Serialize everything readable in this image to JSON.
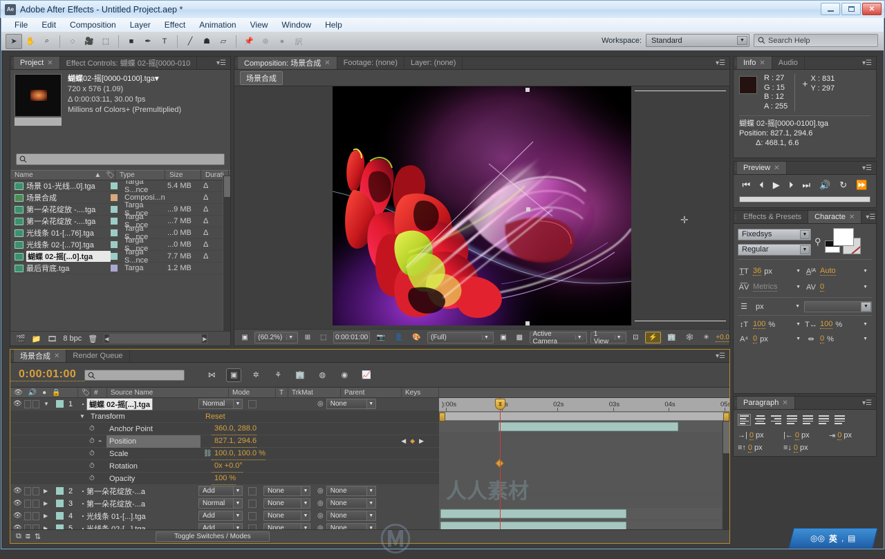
{
  "window": {
    "title": "Adobe After Effects - Untitled Project.aep *",
    "app_badge": "Ae",
    "minimize": "–",
    "maximize": "□",
    "close": "✕"
  },
  "menubar": {
    "items": [
      "File",
      "Edit",
      "Composition",
      "Layer",
      "Effect",
      "Animation",
      "View",
      "Window",
      "Help"
    ]
  },
  "toolbar": {
    "tools": [
      {
        "name": "selection-tool",
        "glyph": "➤",
        "selected": true
      },
      {
        "name": "hand-tool",
        "glyph": "✋",
        "selected": false
      },
      {
        "name": "zoom-tool",
        "glyph": "⌕",
        "selected": false
      },
      {
        "name": "rotation-tool",
        "glyph": "◌",
        "selected": false
      },
      {
        "name": "camera-tool",
        "glyph": "🎥",
        "selected": false
      },
      {
        "name": "pan-behind-tool",
        "glyph": "⬚",
        "selected": false
      },
      {
        "name": "shape-tool",
        "glyph": "■",
        "selected": false
      },
      {
        "name": "pen-tool",
        "glyph": "✒",
        "selected": false
      },
      {
        "name": "type-tool",
        "glyph": "T",
        "selected": false
      },
      {
        "name": "brush-tool",
        "glyph": "╱",
        "selected": false
      },
      {
        "name": "clone-stamp-tool",
        "glyph": "☗",
        "selected": false
      },
      {
        "name": "eraser-tool",
        "glyph": "▱",
        "selected": false
      },
      {
        "name": "puppet-pin-tool",
        "glyph": "📌",
        "selected": false
      }
    ],
    "workspace_label": "Workspace:",
    "workspace_value": "Standard",
    "search_help_placeholder": "Search Help"
  },
  "project_panel": {
    "tabs": [
      {
        "label": "Project",
        "active": true,
        "closeable": true
      },
      {
        "label": "Effect Controls: 蝴蝶 02-摇[0000-010",
        "active": false,
        "closeable": false
      }
    ],
    "selected_item": {
      "name_bold": "蝴蝶",
      "name_rest": "02-摇[0000-0100].tga",
      "dimensions": "720 x 576 (1.09)",
      "duration": "Δ 0:00:03:11, 30.00 fps",
      "colordepth": "Millions of Colors+ (Premultiplied)"
    },
    "search_placeholder": "",
    "columns": [
      "Name",
      "Type",
      "Size",
      "Durati"
    ],
    "items": [
      {
        "name": "场景 01-光线...0].tga",
        "icon": "footage-icon",
        "swatch": "#9ccdc4",
        "type": "Targa S...nce",
        "size": "5.4 MB",
        "dur": "Δ",
        "selected": false
      },
      {
        "name": "场景合成",
        "icon": "composition-icon",
        "swatch": "#d6aa7a",
        "type": "Composi...n",
        "size": "",
        "dur": "Δ",
        "selected": false
      },
      {
        "name": "第一朵花绽放 -....tga",
        "icon": "footage-icon",
        "swatch": "#9ccdc4",
        "type": "Targa S...nce",
        "size": "...9 MB",
        "dur": "Δ",
        "selected": false
      },
      {
        "name": "第一朵花绽放 -....tga",
        "icon": "footage-icon",
        "swatch": "#9ccdc4",
        "type": "Targa S...nce",
        "size": "...7 MB",
        "dur": "Δ",
        "selected": false
      },
      {
        "name": "光线条 01-[...76].tga",
        "icon": "footage-icon",
        "swatch": "#9ccdc4",
        "type": "Targa S...nce",
        "size": "...0 MB",
        "dur": "Δ",
        "selected": false
      },
      {
        "name": "光线条 02-[...70].tga",
        "icon": "footage-icon",
        "swatch": "#9ccdc4",
        "type": "Targa S...nce",
        "size": "...0 MB",
        "dur": "Δ",
        "selected": false
      },
      {
        "name": "蝴蝶 02-摇[...0].tga",
        "icon": "footage-icon",
        "swatch": "#9ccdc4",
        "type": "Targa S...nce",
        "size": "7.7 MB",
        "dur": "Δ",
        "selected": true
      },
      {
        "name": "最后背底.tga",
        "icon": "still-icon",
        "swatch": "#aaa8d0",
        "type": "Targa",
        "size": "1.2 MB",
        "dur": "",
        "selected": false
      }
    ],
    "footer": {
      "bit_depth": "8 bpc",
      "new_comp_icon": "new-composition-icon",
      "new_folder_icon": "new-folder-icon",
      "interpret_icon": "interpret-footage-icon",
      "delete_icon": "delete-icon"
    }
  },
  "comp_panel": {
    "tabs": [
      {
        "label": "Composition: 场景合成",
        "active": true
      },
      {
        "label": "Footage: (none)",
        "active": false
      },
      {
        "label": "Layer: (none)",
        "active": false
      }
    ],
    "breadcrumb": "场景合成",
    "footer": {
      "zoom": "(60.2%)",
      "timecode": "0:00:01:00",
      "resolution": "(Full)",
      "camera": "Active Camera",
      "views": "1 View",
      "exposure": "+0.0"
    }
  },
  "info_panel": {
    "tabs": [
      {
        "label": "Info",
        "active": true
      },
      {
        "label": "Audio",
        "active": false
      }
    ],
    "r_label": "R :",
    "r": "27",
    "g_label": "G :",
    "g": "15",
    "b_label": "B :",
    "b": "12",
    "a_label": "A :",
    "a": "255",
    "x_label": "X :",
    "x": "831",
    "y_label": "Y :",
    "y": "297",
    "swatch_color": "#241210",
    "layer_name": "蝴蝶 02-摇[0000-0100].tga",
    "position": "Position: 827.1, 294.6",
    "delta": "Δ: 468.1, 6.6"
  },
  "preview_panel": {
    "tab": "Preview",
    "buttons": [
      {
        "name": "first-frame-button",
        "glyph": "⏮"
      },
      {
        "name": "previous-frame-button",
        "glyph": "⏴"
      },
      {
        "name": "play-button",
        "glyph": "▶"
      },
      {
        "name": "next-frame-button",
        "glyph": "⏵"
      },
      {
        "name": "last-frame-button",
        "glyph": "⏭"
      },
      {
        "name": "audio-button",
        "glyph": "🔊"
      },
      {
        "name": "loop-button",
        "glyph": "↻"
      },
      {
        "name": "ram-preview-button",
        "glyph": "⏩"
      }
    ]
  },
  "character_panel": {
    "tabs": [
      {
        "label": "Effects & Presets",
        "active": false
      },
      {
        "label": "Characte",
        "active": true
      }
    ],
    "font_family": "Fixedsys",
    "font_style": "Regular",
    "font_size": "36",
    "font_size_unit": "px",
    "leading": "Auto",
    "kerning": "Metrics",
    "tracking": "0",
    "stroke_width": "",
    "stroke_width_unit": "px",
    "vertical_scale": "100",
    "vertical_scale_unit": "%",
    "horizontal_scale": "100",
    "horizontal_scale_unit": "%",
    "baseline_shift": "0",
    "baseline_shift_unit": "px",
    "tsume": "0",
    "tsume_unit": "%"
  },
  "paragraph_panel": {
    "tab": "Paragraph",
    "indent_left": "0",
    "indent_left_unit": "px",
    "indent_right": "0",
    "indent_right_unit": "px",
    "indent_first": "0",
    "indent_first_unit": "px",
    "space_before": "0",
    "space_before_unit": "px",
    "space_after": "0",
    "space_after_unit": "px"
  },
  "timeline": {
    "tabs": [
      {
        "label": "场景合成",
        "active": true
      },
      {
        "label": "Render Queue",
        "active": false
      }
    ],
    "current_time": "0:00:01:00",
    "search_placeholder": "",
    "columns": [
      "#",
      "Source Name",
      "Mode",
      "T",
      "TrkMat",
      "Parent",
      "Keys"
    ],
    "ruler_ticks": [
      "):00s",
      "01s",
      "02s",
      "03s",
      "04s",
      "05s"
    ],
    "layers": [
      {
        "index": "1",
        "name": "蝴蝶 02-摇[...].tga",
        "mode": "Normal",
        "trkmat": "",
        "parent": "None",
        "selected": true,
        "expanded": true,
        "bar_start_pct": 20.5,
        "bar_width_pct": 62,
        "properties": [
          {
            "name": "Transform",
            "value": "Reset",
            "type": "group"
          },
          {
            "name": "Anchor Point",
            "value": "360.0, 288.0",
            "type": "prop"
          },
          {
            "name": "Position",
            "value": "827.1, 294.6",
            "type": "prop",
            "selected": true,
            "keyframed": true
          },
          {
            "name": "Scale",
            "value": "100.0, 100.0 %",
            "type": "prop",
            "linked": true
          },
          {
            "name": "Rotation",
            "value": "0x +0.0°",
            "type": "prop"
          },
          {
            "name": "Opacity",
            "value": "100 %",
            "type": "prop"
          }
        ]
      },
      {
        "index": "2",
        "name": "第一朵花绽放-...a",
        "mode": "Add",
        "trkmat": "None",
        "parent": "None",
        "selected": false,
        "expanded": false,
        "bar_start_pct": 0.5,
        "bar_width_pct": 64
      },
      {
        "index": "3",
        "name": "第一朵花绽放-...a",
        "mode": "Normal",
        "trkmat": "None",
        "parent": "None",
        "selected": false,
        "expanded": false,
        "bar_start_pct": 0.5,
        "bar_width_pct": 64
      },
      {
        "index": "4",
        "name": "光线条 01-[...].tga",
        "mode": "Add",
        "trkmat": "None",
        "parent": "None",
        "selected": false,
        "expanded": false,
        "bar_start_pct": 0.5,
        "bar_width_pct": 99
      },
      {
        "index": "5",
        "name": "光线条 02-[...].tga",
        "mode": "Add",
        "trkmat": "None",
        "parent": "None",
        "selected": false,
        "expanded": false,
        "bar_start_pct": 0.5,
        "bar_width_pct": 64
      }
    ],
    "toggle_button": "Toggle Switches / Modes",
    "watermark": "人人素材"
  },
  "ime": {
    "lang": "英",
    "items": [
      "⁀",
      "•,",
      "国"
    ]
  }
}
